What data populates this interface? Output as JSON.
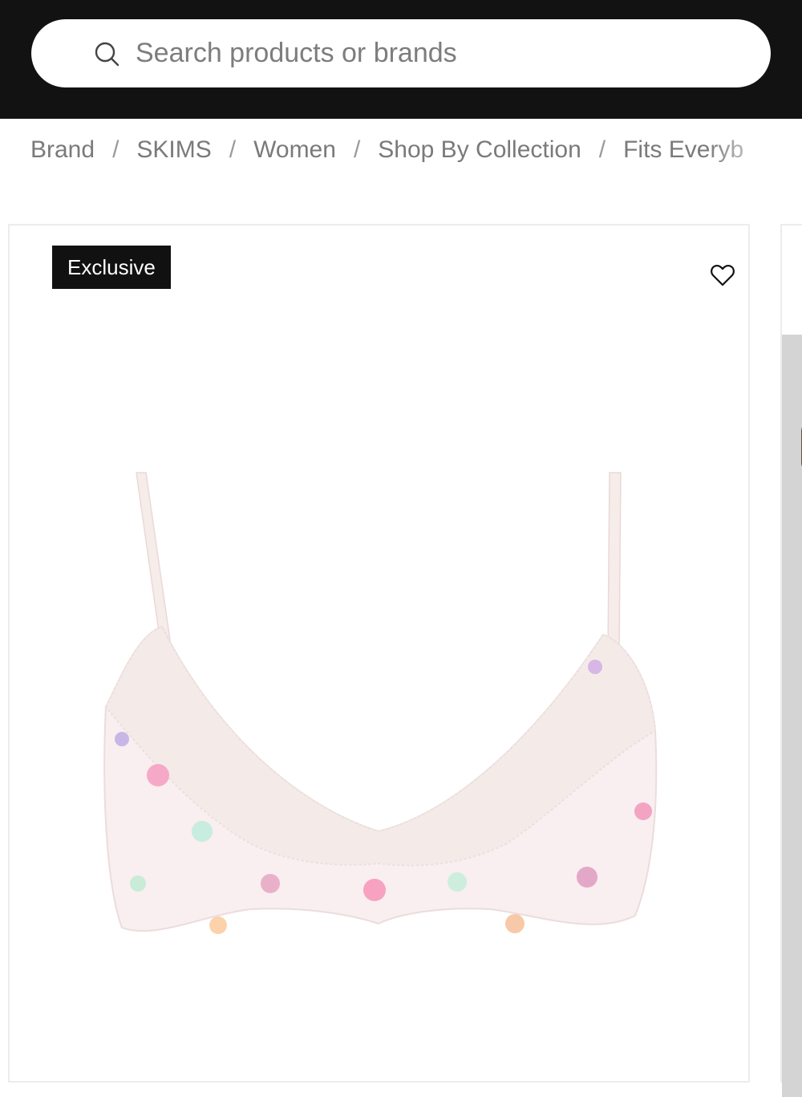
{
  "search": {
    "placeholder": "Search products or brands",
    "icon": "search-icon"
  },
  "breadcrumb": {
    "items": [
      "Brand",
      "SKIMS",
      "Women",
      "Shop By Collection",
      "Fits Everyb"
    ],
    "separator": "/"
  },
  "product": {
    "badge": "Exclusive",
    "favorite_icon": "heart-outline-icon",
    "image_alt": "pink heart print lace bralette",
    "colors": {
      "badge_bg": "#111111",
      "fabric": "#f9eef0",
      "lace": "#f4ebe9"
    }
  },
  "colors": {
    "topbar": "#121212",
    "breadcrumb_text": "#7a7a7a"
  }
}
